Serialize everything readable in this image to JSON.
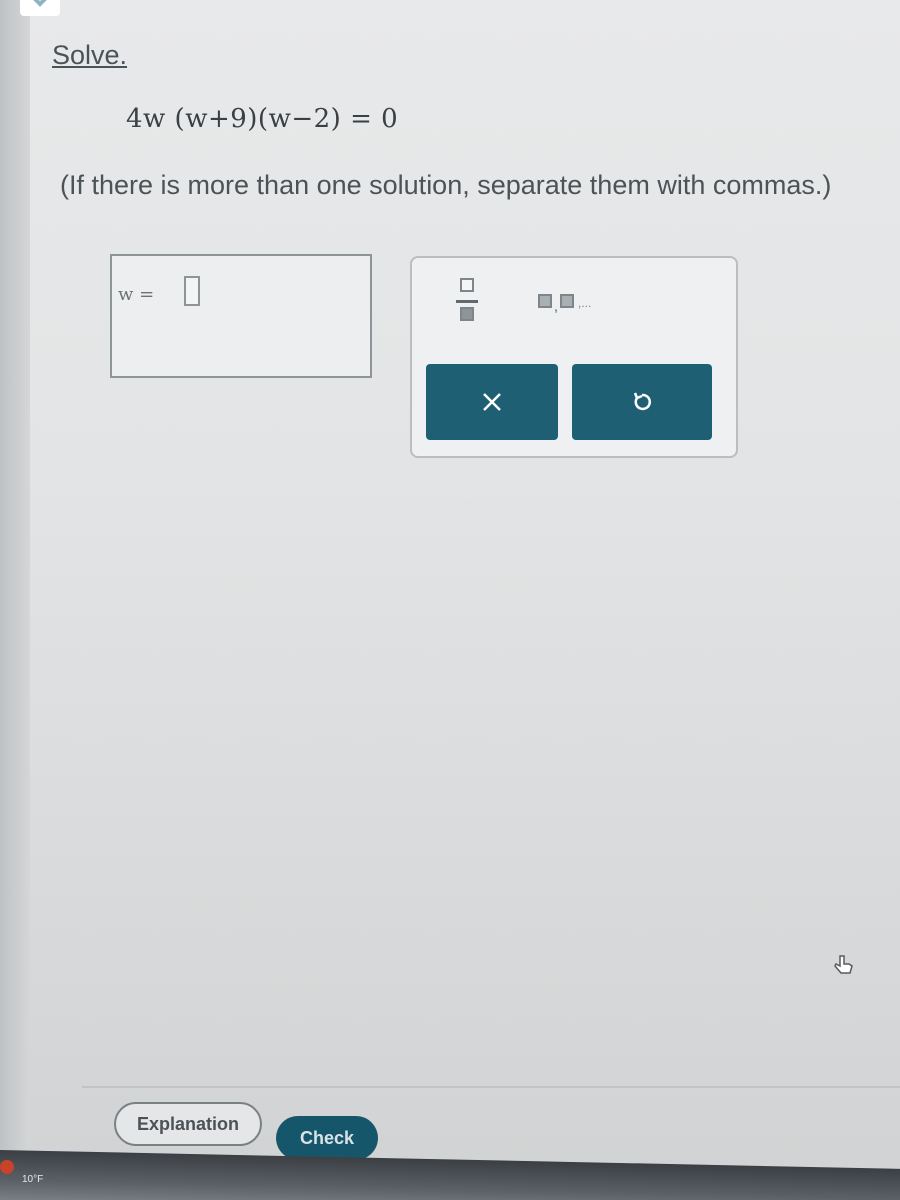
{
  "prompt": {
    "title": "Solve.",
    "equation": "4w (w+9)(w−2) = 0",
    "instruction": "(If there is more than one solution, separate them with commas.)"
  },
  "answer": {
    "variable": "w =",
    "value": ""
  },
  "keypad": {
    "fraction_icon": "fraction-icon",
    "list_icon": "comma-list-icon",
    "clear_icon": "close-icon",
    "undo_icon": "undo-icon"
  },
  "footer": {
    "explanation_label": "Explanation",
    "check_label": "Check"
  },
  "taskbar": {
    "temperature": "10°F"
  },
  "colors": {
    "button_teal": "#1f5f73",
    "check_teal": "#16566a"
  }
}
